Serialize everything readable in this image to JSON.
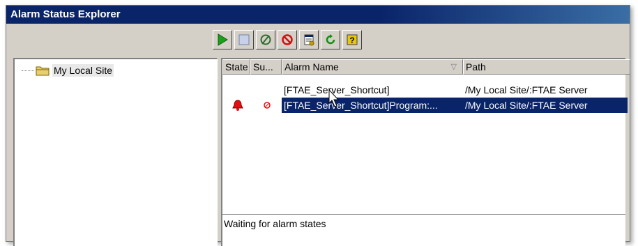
{
  "window": {
    "title": "Alarm Status Explorer"
  },
  "toolbar": {
    "buttons": [
      {
        "name": "start-icon",
        "color": "#1aa01a"
      },
      {
        "name": "stop-icon",
        "color": "#c8d0e8"
      },
      {
        "name": "disable-icon",
        "color": "#2e6b2e"
      },
      {
        "name": "prohibit-icon",
        "color": "#d01010"
      },
      {
        "name": "properties-icon",
        "color": "#c8a000"
      },
      {
        "name": "refresh-icon",
        "color": "#109010"
      },
      {
        "name": "help-icon",
        "color": "#e8c800"
      }
    ]
  },
  "tree": {
    "items": [
      {
        "label": "My Local Site",
        "icon": "folder-icon"
      }
    ]
  },
  "list": {
    "columns": [
      {
        "label": "State"
      },
      {
        "label": "Su..."
      },
      {
        "label": "Alarm Name",
        "sort_icon": "sort-descending-icon"
      },
      {
        "label": "Path"
      }
    ],
    "rows": [
      {
        "state_icon": "",
        "suppressed_icon": "",
        "alarm_name": "[FTAE_Server_Shortcut]",
        "path": "/My Local Site/:FTAE Server",
        "selected": false
      },
      {
        "state_icon": "bell-alarm-icon",
        "suppressed_icon": "suppressed-icon",
        "alarm_name": "[FTAE_Server_Shortcut]Program:...",
        "path": "/My Local Site/:FTAE Server",
        "selected": true
      }
    ]
  },
  "status": {
    "text": "Waiting for alarm states"
  }
}
